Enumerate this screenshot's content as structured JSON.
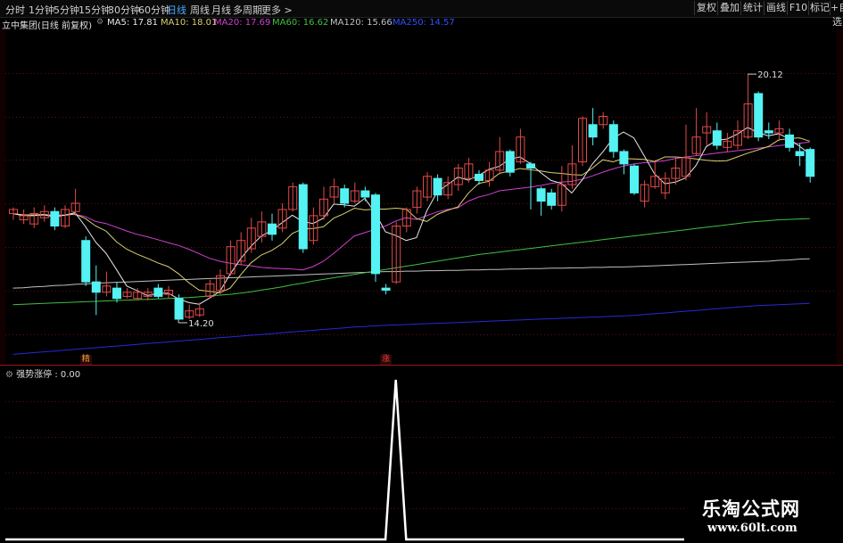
{
  "toolbar": {
    "timeframes": [
      {
        "label": "分时",
        "active": false
      },
      {
        "label": "1分钟",
        "active": false
      },
      {
        "label": "5分钟",
        "active": false
      },
      {
        "label": "15分钟",
        "active": false
      },
      {
        "label": "30分钟",
        "active": false
      },
      {
        "label": "60分钟",
        "active": false
      },
      {
        "label": "日线",
        "active": true
      },
      {
        "label": "周线",
        "active": false
      },
      {
        "label": "月线",
        "active": false
      },
      {
        "label": "多周期",
        "active": false
      },
      {
        "label": "更多 >",
        "active": false
      }
    ],
    "right_buttons": [
      "复权",
      "叠加",
      "统计",
      "画线",
      "F10",
      "标记",
      "+自选"
    ]
  },
  "info": {
    "title": "立中集团(日线 前复权)",
    "ma5": "MA5: 17.81",
    "ma10": "MA10: 18.01",
    "ma20": "MA20: 17.69",
    "ma60": "MA60: 16.62",
    "ma120": "MA120: 15.66",
    "ma250": "MA250: 14.57"
  },
  "colors": {
    "up": "#e24a4a",
    "down": "#54f2f2",
    "ma5": "#e8e8e8",
    "ma10": "#d8d070",
    "ma20": "#d040d0",
    "ma60": "#40c040",
    "ma120": "#c0c0c0",
    "ma250": "#2828d8",
    "indicator": "#ffffff"
  },
  "chart_data": {
    "type": "candlestick",
    "y_range": [
      13.1,
      21.2
    ],
    "high_label": "20.12",
    "low_label": "14.20",
    "candles": [
      [
        16.75,
        16.85,
        16.9,
        16.6
      ],
      [
        16.6,
        16.7,
        16.85,
        16.5
      ],
      [
        16.5,
        16.75,
        16.9,
        16.4
      ],
      [
        16.65,
        16.8,
        16.95,
        16.55
      ],
      [
        16.8,
        16.45,
        16.9,
        16.35
      ],
      [
        16.45,
        16.85,
        16.95,
        16.4
      ],
      [
        16.8,
        17.0,
        17.35,
        16.7
      ],
      [
        16.1,
        15.1,
        16.2,
        15.0
      ],
      [
        15.1,
        14.85,
        15.5,
        14.3
      ],
      [
        14.85,
        15.0,
        15.35,
        14.75
      ],
      [
        14.95,
        14.7,
        15.1,
        14.6
      ],
      [
        14.75,
        14.85,
        14.95,
        14.7
      ],
      [
        14.7,
        14.85,
        14.95,
        14.65
      ],
      [
        14.75,
        14.85,
        14.95,
        14.65
      ],
      [
        14.95,
        14.75,
        15.05,
        14.7
      ],
      [
        14.8,
        14.9,
        15.0,
        14.7
      ],
      [
        14.7,
        14.2,
        14.8,
        14.2
      ],
      [
        14.25,
        14.4,
        14.55,
        14.2
      ],
      [
        14.3,
        14.45,
        14.6,
        14.25
      ],
      [
        14.75,
        15.05,
        15.15,
        14.7
      ],
      [
        14.9,
        15.25,
        15.4,
        14.8
      ],
      [
        15.3,
        15.95,
        16.1,
        15.25
      ],
      [
        15.6,
        16.1,
        16.3,
        15.5
      ],
      [
        15.9,
        16.4,
        16.65,
        15.8
      ],
      [
        16.2,
        16.55,
        16.8,
        16.05
      ],
      [
        16.5,
        16.25,
        16.75,
        16.1
      ],
      [
        16.4,
        16.85,
        17.0,
        16.3
      ],
      [
        16.85,
        17.4,
        17.5,
        16.8
      ],
      [
        17.45,
        15.9,
        17.5,
        15.8
      ],
      [
        16.1,
        16.7,
        16.9,
        16.0
      ],
      [
        16.7,
        17.1,
        17.4,
        16.6
      ],
      [
        17.15,
        17.4,
        17.6,
        17.0
      ],
      [
        17.35,
        17.0,
        17.45,
        16.9
      ],
      [
        17.05,
        17.3,
        17.5,
        17.0
      ],
      [
        17.3,
        17.15,
        17.4,
        17.05
      ],
      [
        17.2,
        15.3,
        17.25,
        15.1
      ],
      [
        14.95,
        14.9,
        15.05,
        14.8
      ],
      [
        15.1,
        16.45,
        16.55,
        15.05
      ],
      [
        16.45,
        16.85,
        16.9,
        16.3
      ],
      [
        16.9,
        17.3,
        17.4,
        16.75
      ],
      [
        17.15,
        17.65,
        17.75,
        17.05
      ],
      [
        17.6,
        17.2,
        17.7,
        17.05
      ],
      [
        17.2,
        17.5,
        17.65,
        17.1
      ],
      [
        17.45,
        17.85,
        17.95,
        17.3
      ],
      [
        17.6,
        17.95,
        18.1,
        17.5
      ],
      [
        17.7,
        17.55,
        17.8,
        17.45
      ],
      [
        17.55,
        17.8,
        18.0,
        17.4
      ],
      [
        17.8,
        18.25,
        18.6,
        17.7
      ],
      [
        18.25,
        17.75,
        18.3,
        17.65
      ],
      [
        18.0,
        18.6,
        18.8,
        17.95
      ],
      [
        17.95,
        17.85,
        18.0,
        16.85
      ],
      [
        17.35,
        17.05,
        17.4,
        16.7
      ],
      [
        17.25,
        16.95,
        17.35,
        16.85
      ],
      [
        16.95,
        17.45,
        17.9,
        16.8
      ],
      [
        17.45,
        17.95,
        18.4,
        17.35
      ],
      [
        18.0,
        19.05,
        19.1,
        17.9
      ],
      [
        18.9,
        18.6,
        19.3,
        18.4
      ],
      [
        18.9,
        19.1,
        19.2,
        18.8
      ],
      [
        18.9,
        18.25,
        19.0,
        18.1
      ],
      [
        18.25,
        17.95,
        18.3,
        17.7
      ],
      [
        17.9,
        17.25,
        17.95,
        17.2
      ],
      [
        17.05,
        17.45,
        17.55,
        16.9
      ],
      [
        17.4,
        17.65,
        18.0,
        17.35
      ],
      [
        17.25,
        17.6,
        17.75,
        17.1
      ],
      [
        17.6,
        17.85,
        18.1,
        17.45
      ],
      [
        17.65,
        18.1,
        18.9,
        17.55
      ],
      [
        18.2,
        18.6,
        19.3,
        18.15
      ],
      [
        18.7,
        18.85,
        19.2,
        18.4
      ],
      [
        18.75,
        18.4,
        18.95,
        18.3
      ],
      [
        18.35,
        18.5,
        18.7,
        18.25
      ],
      [
        18.4,
        18.75,
        19.0,
        18.3
      ],
      [
        18.6,
        19.4,
        20.12,
        18.55
      ],
      [
        19.65,
        18.6,
        19.7,
        18.5
      ],
      [
        18.75,
        18.7,
        18.95,
        18.55
      ],
      [
        18.7,
        18.8,
        19.0,
        18.5
      ],
      [
        18.65,
        18.35,
        18.8,
        18.25
      ],
      [
        18.25,
        18.15,
        18.45,
        17.9
      ],
      [
        18.3,
        17.65,
        18.35,
        17.5
      ]
    ],
    "ma5": [
      16.75,
      16.7,
      16.7,
      16.72,
      16.67,
      16.71,
      16.77,
      16.44,
      16.06,
      15.79,
      15.4,
      15.0,
      14.89,
      14.77,
      14.82,
      14.83,
      14.69,
      14.6,
      14.56,
      14.71,
      14.87,
      15.29,
      15.66,
      15.96,
      16.21,
      16.34,
      16.53,
      16.71,
      16.56,
      16.51,
      16.64,
      16.98,
      16.96,
      16.93,
      17.12,
      16.77,
      16.31,
      16.22,
      16.1,
      16.17,
      16.82,
      17.27,
      17.45,
      17.63,
      17.56,
      17.67,
      17.82,
      17.89,
      18.07,
      18.12,
      17.96,
      17.74,
      17.55,
      17.48,
      17.25,
      17.56,
      17.95,
      18.24,
      18.57,
      18.72,
      18.58,
      18.15,
      17.71,
      17.47,
      17.51,
      17.61,
      17.91,
      18.37,
      18.52,
      18.55,
      18.67,
      18.83,
      18.71,
      18.63,
      18.68,
      18.56,
      18.38,
      18.19
    ],
    "ma10": [
      16.75,
      16.72,
      16.72,
      16.73,
      16.7,
      16.71,
      16.74,
      16.63,
      16.45,
      16.33,
      16.07,
      15.89,
      15.77,
      15.67,
      15.56,
      15.47,
      15.3,
      15.08,
      14.9,
      14.87,
      14.84,
      14.95,
      15.27,
      15.56,
      15.75,
      15.86,
      16.02,
      16.27,
      16.38,
      16.39,
      16.43,
      16.64,
      16.75,
      16.88,
      16.84,
      16.86,
      16.86,
      16.88,
      16.86,
      16.63,
      16.56,
      16.73,
      16.83,
      16.91,
      17.24,
      17.48,
      17.53,
      17.72,
      17.78,
      17.84,
      17.81,
      17.78,
      17.74,
      17.72,
      17.69,
      17.68,
      17.85,
      18.05,
      18.0,
      18.08,
      18.07,
      18.06,
      18.01,
      18.12,
      18.12,
      18.1,
      18.07,
      18.04,
      18.02,
      18.03,
      18.12,
      18.21,
      18.29,
      18.37,
      18.53,
      18.56,
      18.58,
      18.5
    ],
    "ma20": [
      16.75,
      16.72,
      16.72,
      16.72,
      16.71,
      16.72,
      16.73,
      16.68,
      16.56,
      16.51,
      16.42,
      16.33,
      16.25,
      16.19,
      16.12,
      16.05,
      15.98,
      15.89,
      15.78,
      15.67,
      15.6,
      15.55,
      15.52,
      15.49,
      15.45,
      15.43,
      15.42,
      15.41,
      15.39,
      15.47,
      15.6,
      15.79,
      16.0,
      16.21,
      16.29,
      16.37,
      16.45,
      16.57,
      16.65,
      16.61,
      16.7,
      16.79,
      16.85,
      16.89,
      17.05,
      17.15,
      17.21,
      17.3,
      17.33,
      17.36,
      17.39,
      17.43,
      17.48,
      17.51,
      17.53,
      17.58,
      17.66,
      17.75,
      17.83,
      17.9,
      17.95,
      17.98,
      18.0,
      18.03,
      18.08,
      18.12,
      18.15,
      18.18,
      18.21,
      18.24,
      18.27,
      18.3,
      18.33,
      18.36,
      18.39,
      18.42,
      18.45,
      18.48
    ],
    "ma60": [
      14.55,
      14.56,
      14.57,
      14.58,
      14.59,
      14.6,
      14.61,
      14.62,
      14.63,
      14.64,
      14.65,
      14.66,
      14.67,
      14.68,
      14.69,
      14.7,
      14.71,
      14.72,
      14.74,
      14.76,
      14.78,
      14.8,
      14.83,
      14.86,
      14.9,
      14.94,
      14.98,
      15.03,
      15.07,
      15.12,
      15.16,
      15.2,
      15.24,
      15.28,
      15.32,
      15.36,
      15.4,
      15.44,
      15.48,
      15.52,
      15.56,
      15.6,
      15.64,
      15.68,
      15.72,
      15.76,
      15.79,
      15.82,
      15.85,
      15.88,
      15.91,
      15.94,
      15.97,
      16.0,
      16.03,
      16.06,
      16.09,
      16.12,
      16.15,
      16.18,
      16.21,
      16.24,
      16.27,
      16.3,
      16.33,
      16.36,
      16.39,
      16.42,
      16.45,
      16.48,
      16.51,
      16.54,
      16.56,
      16.58,
      16.6,
      16.61,
      16.62,
      16.63
    ],
    "ma120": [
      14.95,
      14.96,
      14.98,
      14.99,
      15.01,
      15.02,
      15.04,
      15.05,
      15.07,
      15.08,
      15.09,
      15.1,
      15.11,
      15.12,
      15.13,
      15.14,
      15.15,
      15.16,
      15.17,
      15.18,
      15.19,
      15.2,
      15.21,
      15.22,
      15.23,
      15.24,
      15.25,
      15.26,
      15.27,
      15.28,
      15.29,
      15.3,
      15.31,
      15.32,
      15.33,
      15.34,
      15.35,
      15.35,
      15.36,
      15.36,
      15.37,
      15.37,
      15.38,
      15.38,
      15.39,
      15.39,
      15.4,
      15.4,
      15.41,
      15.41,
      15.42,
      15.42,
      15.43,
      15.43,
      15.44,
      15.44,
      15.45,
      15.45,
      15.46,
      15.46,
      15.47,
      15.48,
      15.49,
      15.5,
      15.51,
      15.52,
      15.53,
      15.54,
      15.55,
      15.56,
      15.57,
      15.58,
      15.59,
      15.6,
      15.62,
      15.63,
      15.65,
      15.66
    ],
    "ma250": [
      13.35,
      13.37,
      13.39,
      13.41,
      13.43,
      13.45,
      13.47,
      13.49,
      13.51,
      13.53,
      13.55,
      13.57,
      13.59,
      13.61,
      13.63,
      13.65,
      13.67,
      13.69,
      13.71,
      13.73,
      13.75,
      13.77,
      13.79,
      13.81,
      13.83,
      13.85,
      13.87,
      13.89,
      13.91,
      13.93,
      13.95,
      13.97,
      13.99,
      14.01,
      14.02,
      14.04,
      14.05,
      14.06,
      14.07,
      14.08,
      14.09,
      14.1,
      14.11,
      14.12,
      14.13,
      14.14,
      14.15,
      14.16,
      14.17,
      14.18,
      14.19,
      14.2,
      14.21,
      14.22,
      14.23,
      14.24,
      14.25,
      14.26,
      14.27,
      14.28,
      14.29,
      14.31,
      14.33,
      14.35,
      14.37,
      14.39,
      14.41,
      14.43,
      14.45,
      14.47,
      14.49,
      14.51,
      14.53,
      14.54,
      14.55,
      14.56,
      14.57,
      14.58
    ],
    "markers": [
      {
        "index": 7,
        "text": "精",
        "color": "#f0a030"
      },
      {
        "index": 36,
        "text": "涨",
        "color": "#ff3a3a"
      }
    ]
  },
  "indicator": {
    "title": "强势涨停 : 0.00",
    "series_name": "强势涨停",
    "values": [
      0,
      0,
      0,
      0,
      0,
      0,
      0,
      0,
      0,
      0,
      0,
      0,
      0,
      0,
      0,
      0,
      0,
      0,
      0,
      0,
      0,
      0,
      0,
      0,
      0,
      0,
      0,
      0,
      0,
      0,
      0,
      0,
      0,
      0,
      0,
      0,
      0,
      1,
      0,
      0,
      0,
      0,
      0,
      0,
      0,
      0,
      0,
      0,
      0,
      0,
      0,
      0,
      0,
      0,
      0,
      0,
      0,
      0,
      0,
      0,
      0,
      0,
      0,
      0,
      0,
      0,
      0,
      0,
      0,
      0,
      0,
      0,
      0,
      0,
      0,
      0,
      0,
      0
    ]
  },
  "watermark": {
    "line1": "乐淘公式网",
    "line2": "www.60lt.com"
  }
}
